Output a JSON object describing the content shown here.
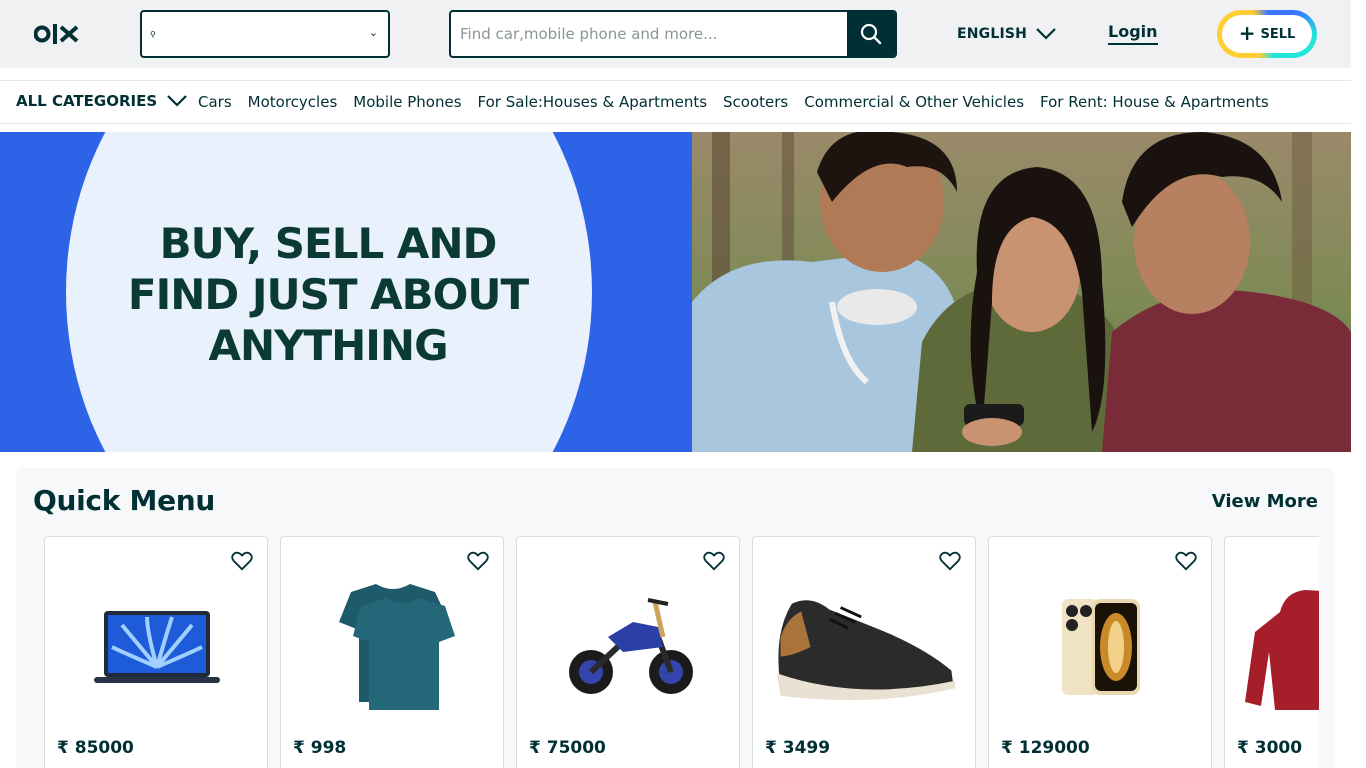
{
  "header": {
    "logo_text": "olx",
    "location_value": "",
    "search_placeholder": "Find car,mobile phone and more...",
    "language_label": "ENGLISH",
    "login_label": "Login",
    "sell_label": "SELL",
    "icons": [
      "search-icon",
      "chevron-down-icon",
      "plus-icon",
      "location-icon"
    ]
  },
  "categories": {
    "all_label": "ALL CATEGORIES",
    "links": [
      "Cars",
      "Motorcycles",
      "Mobile Phones",
      "For Sale:Houses & Apartments",
      "Scooters",
      "Commercial & Other Vehicles",
      "For Rent: House & Apartments"
    ]
  },
  "hero": {
    "line1": "BUY, SELL AND",
    "line2": "FIND JUST ABOUT",
    "line3": "ANYTHING",
    "colors": {
      "panel": "#2d63e7",
      "circle": "#e9f1fd",
      "text": "#0b3a35"
    }
  },
  "quick_menu": {
    "title": "Quick Menu",
    "view_more": "View More",
    "cards": [
      {
        "price": "₹ 85000",
        "image": "laptop"
      },
      {
        "price": "₹ 998",
        "image": "t-shirt"
      },
      {
        "price": "₹ 75000",
        "image": "motorcycle"
      },
      {
        "price": "₹ 3499",
        "image": "sneaker"
      },
      {
        "price": "₹ 129000",
        "image": "smartphone"
      },
      {
        "price": "₹ 3000",
        "image": "hoodie"
      }
    ]
  },
  "colors": {
    "brand": "#002f34",
    "header_bg": "#eff1f3"
  }
}
